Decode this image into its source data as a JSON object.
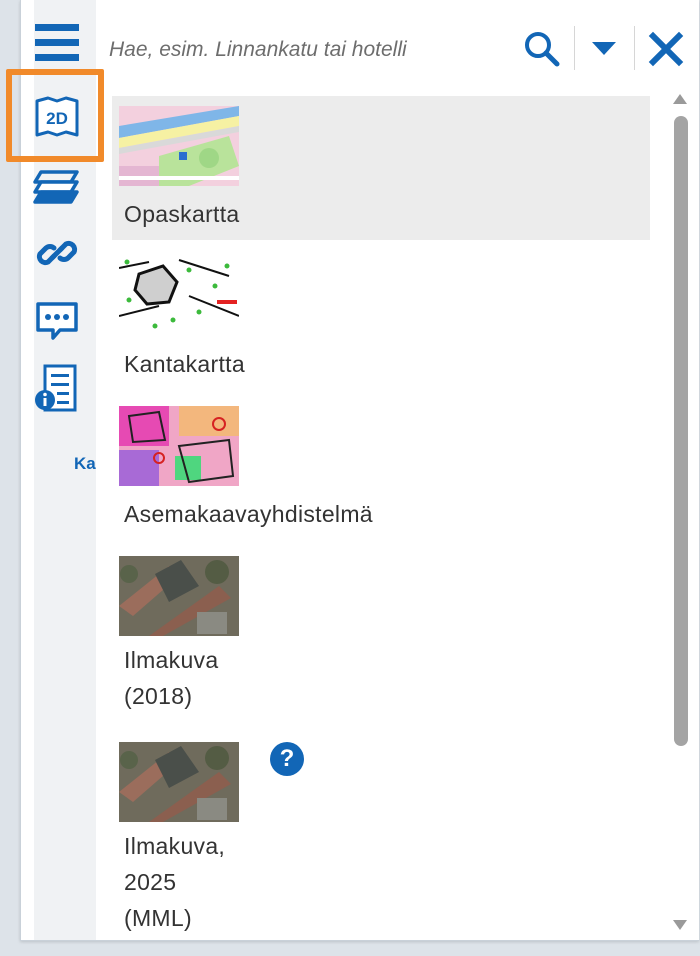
{
  "search": {
    "placeholder": "Hae, esim. Linnankatu tai hotelli"
  },
  "sidebar": {
    "truncated_label": "Ka"
  },
  "layers": [
    {
      "label": "Opaskartta",
      "selected": true
    },
    {
      "label": "Kantakartta",
      "selected": false
    },
    {
      "label": "Asemakaavayhdistelmä",
      "selected": false
    },
    {
      "label": "Ilmakuva\n(2018)",
      "selected": false
    },
    {
      "label": "Ilmakuva,\n2025\n(MML)",
      "selected": false,
      "help": "?"
    }
  ],
  "colors": {
    "accent": "#1266b6",
    "highlight": "#f18a2a",
    "selected_bg": "#ececec"
  }
}
